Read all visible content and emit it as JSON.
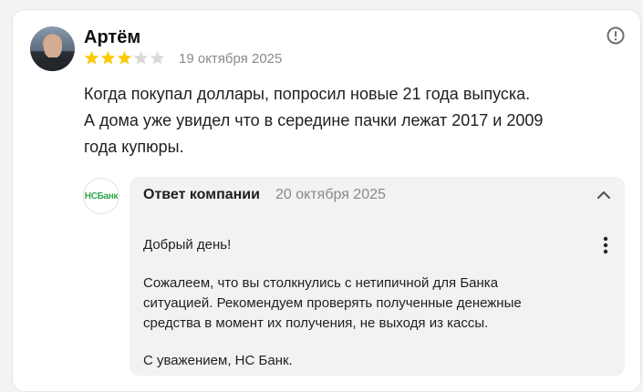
{
  "review": {
    "author": "Артём",
    "rating": 3,
    "max_rating": 5,
    "date": "19 октября 2025",
    "text_lines": [
      "Когда покупал доллары, попросил новые 21 года выпуска.",
      "А дома уже увидел что в середине пачки лежат 2017 и 2009",
      "года купюры."
    ]
  },
  "reply": {
    "logo_text": "НСБанк",
    "title": "Ответ компании",
    "date": "20 октября 2025",
    "greeting": "Добрый день!",
    "body_lines": [
      "Сожалеем, что вы столкнулись с нетипичной для Банка",
      "ситуацией. Рекомендуем проверять полученные денежные",
      "средства в момент их получения, не выходя из кассы."
    ],
    "signature": "С уважением, НС Банк."
  },
  "colors": {
    "star_filled": "#fcca00",
    "star_empty": "#d9d9d9",
    "logo_green": "#2fa84f",
    "muted_text": "#8a8a8a"
  },
  "icons": {
    "report": "exclamation-circle-icon",
    "collapse": "chevron-up-icon",
    "menu": "kebab-menu-icon"
  }
}
